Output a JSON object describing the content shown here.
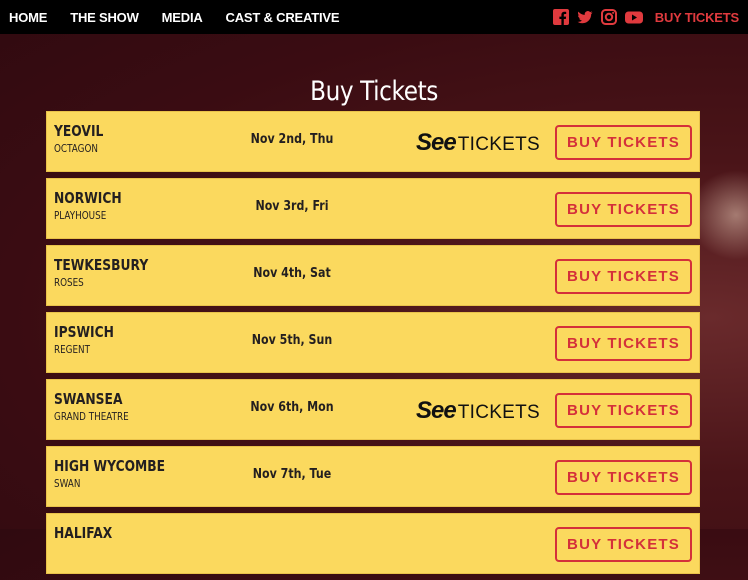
{
  "nav": {
    "items": [
      "HOME",
      "THE SHOW",
      "MEDIA",
      "CAST & CREATIVE"
    ],
    "cta": "BUY TICKETS"
  },
  "social_icons": [
    "facebook-icon",
    "twitter-icon",
    "instagram-icon",
    "youtube-icon"
  ],
  "colors": {
    "accent": "#e03a3e",
    "row_bg": "#fbd95e",
    "page_bg": "#3a0c12"
  },
  "page_title": "Buy Tickets",
  "tickets": [
    {
      "venue": "YEOVIL",
      "theatre": "OCTAGON",
      "date": "Nov 2nd, Thu",
      "see_tickets": true,
      "button": "BUY TICKETS"
    },
    {
      "venue": "NORWICH",
      "theatre": "PLAYHOUSE",
      "date": "Nov 3rd, Fri",
      "see_tickets": false,
      "button": "BUY TICKETS"
    },
    {
      "venue": "TEWKESBURY",
      "theatre": "ROSES",
      "date": "Nov 4th, Sat",
      "see_tickets": false,
      "button": "BUY TICKETS"
    },
    {
      "venue": "IPSWICH",
      "theatre": "REGENT",
      "date": "Nov 5th, Sun",
      "see_tickets": false,
      "button": "BUY TICKETS"
    },
    {
      "venue": "SWANSEA",
      "theatre": "GRAND THEATRE",
      "date": "Nov 6th, Mon",
      "see_tickets": true,
      "button": "BUY TICKETS"
    },
    {
      "venue": "HIGH WYCOMBE",
      "theatre": "SWAN",
      "date": "Nov 7th, Tue",
      "see_tickets": false,
      "button": "BUY TICKETS"
    },
    {
      "venue": "HALIFAX",
      "theatre": "",
      "date": "",
      "see_tickets": false,
      "button": "BUY TICKETS"
    }
  ],
  "see_tickets_logo": {
    "see": "See",
    "tickets": "TICKETS"
  }
}
